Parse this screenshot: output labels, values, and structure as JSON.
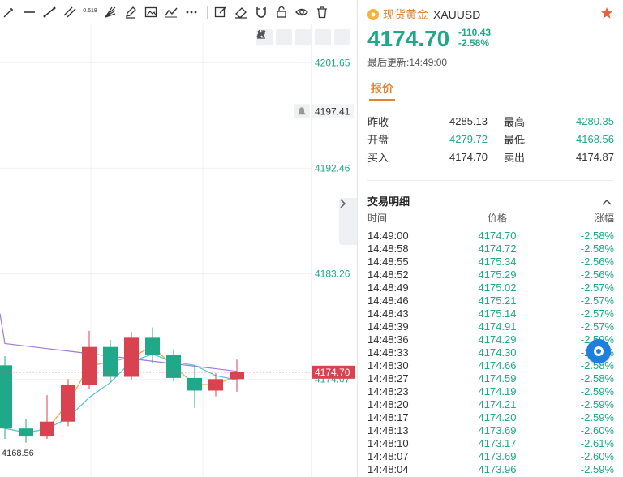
{
  "toolbar": {
    "fib_label": "0.618"
  },
  "chart": {
    "price_labels": [
      "4201.65",
      "4197.41",
      "4192.46",
      "4183.26",
      "4174.07"
    ],
    "current_price_tag": "4174.70",
    "low_label": "4168.56",
    "colors": {
      "up": "#d9424f",
      "down": "#1fa989",
      "ma_fast": "#f2a23b",
      "ma_mid": "#a07ad8",
      "ma_slow": "#4fc3d9"
    }
  },
  "chart_data": {
    "type": "candlestick",
    "title": "",
    "ylim": [
      4166,
      4204
    ],
    "y_ticks": [
      4201.65,
      4197.41,
      4192.46,
      4183.26,
      4174.07
    ],
    "candles": [
      {
        "open": 4175.3,
        "high": 4176.1,
        "close": 4169.8,
        "low": 4168.9
      },
      {
        "open": 4169.8,
        "high": 4170.6,
        "close": 4169.1,
        "low": 4168.56
      },
      {
        "open": 4169.1,
        "high": 4172.7,
        "close": 4170.4,
        "low": 4168.9
      },
      {
        "open": 4170.4,
        "high": 4174.1,
        "close": 4173.6,
        "low": 4170.0
      },
      {
        "open": 4173.6,
        "high": 4178.3,
        "close": 4176.9,
        "low": 4173.2
      },
      {
        "open": 4176.9,
        "high": 4177.5,
        "close": 4174.3,
        "low": 4173.8
      },
      {
        "open": 4174.3,
        "high": 4178.2,
        "close": 4177.7,
        "low": 4174.0
      },
      {
        "open": 4177.7,
        "high": 4178.6,
        "close": 4176.2,
        "low": 4175.5
      },
      {
        "open": 4176.2,
        "high": 4176.7,
        "close": 4174.2,
        "low": 4173.9
      },
      {
        "open": 4174.2,
        "high": 4175.2,
        "close": 4173.1,
        "low": 4171.6
      },
      {
        "open": 4173.1,
        "high": 4174.6,
        "close": 4174.1,
        "low": 4172.6
      },
      {
        "open": 4174.1,
        "high": 4175.8,
        "close": 4174.7,
        "low": 4173.0
      }
    ]
  },
  "quote": {
    "symbol_name": "现货黄金",
    "symbol_code": "XAUUSD",
    "price": "4174.70",
    "change": "-110.43",
    "change_pct": "-2.58%",
    "updated_label": "最后更新:14:49:00",
    "tab_label": "报价",
    "rows": [
      {
        "l1": "昨收",
        "v1": "4285.13",
        "c1": "dark",
        "l2": "最高",
        "v2": "4280.35",
        "c2": "green"
      },
      {
        "l1": "开盘",
        "v1": "4279.72",
        "c1": "green",
        "l2": "最低",
        "v2": "4168.56",
        "c2": "green"
      },
      {
        "l1": "买入",
        "v1": "4174.70",
        "c1": "dark",
        "l2": "卖出",
        "v2": "4174.87",
        "c2": "dark"
      }
    ]
  },
  "trades": {
    "title": "交易明细",
    "headers": [
      "时间",
      "价格",
      "涨幅"
    ],
    "rows": [
      [
        "14:49:00",
        "4174.70",
        "-2.58%"
      ],
      [
        "14:48:58",
        "4174.72",
        "-2.58%"
      ],
      [
        "14:48:55",
        "4175.34",
        "-2.56%"
      ],
      [
        "14:48:52",
        "4175.29",
        "-2.56%"
      ],
      [
        "14:48:49",
        "4175.02",
        "-2.57%"
      ],
      [
        "14:48:46",
        "4175.21",
        "-2.57%"
      ],
      [
        "14:48:43",
        "4175.14",
        "-2.57%"
      ],
      [
        "14:48:39",
        "4174.91",
        "-2.57%"
      ],
      [
        "14:48:36",
        "4174.29",
        "-2.59%"
      ],
      [
        "14:48:33",
        "4174.30",
        "-2.59%"
      ],
      [
        "14:48:30",
        "4174.66",
        "-2.58%"
      ],
      [
        "14:48:27",
        "4174.59",
        "-2.58%"
      ],
      [
        "14:48:23",
        "4174.19",
        "-2.59%"
      ],
      [
        "14:48:20",
        "4174.21",
        "-2.59%"
      ],
      [
        "14:48:17",
        "4174.20",
        "-2.59%"
      ],
      [
        "14:48:13",
        "4173.69",
        "-2.60%"
      ],
      [
        "14:48:10",
        "4173.17",
        "-2.61%"
      ],
      [
        "14:48:07",
        "4173.69",
        "-2.60%"
      ],
      [
        "14:48:04",
        "4173.96",
        "-2.59%"
      ]
    ]
  }
}
